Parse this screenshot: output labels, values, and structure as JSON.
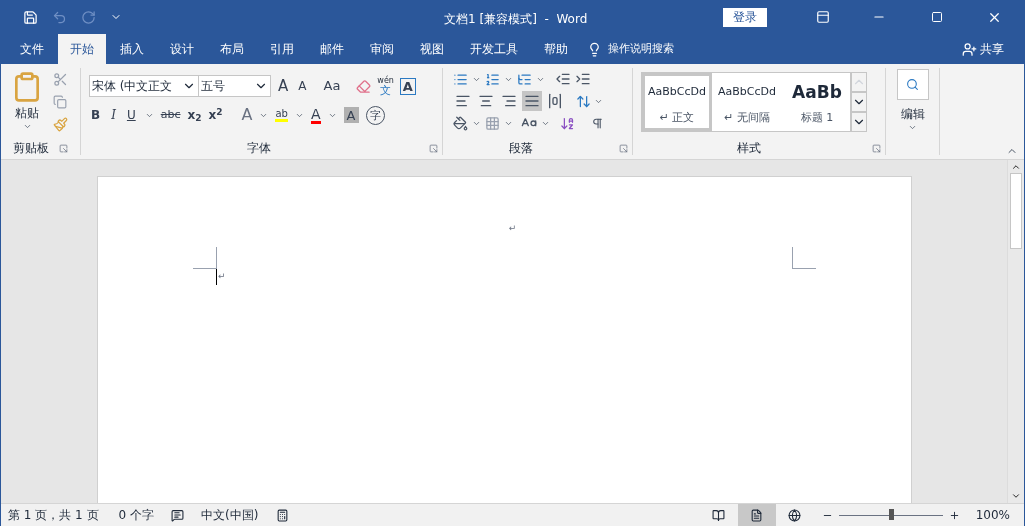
{
  "window": {
    "title": "文档1 [兼容模式]  -  Word",
    "login": "登录"
  },
  "tabs": [
    {
      "label": "文件",
      "selected": false
    },
    {
      "label": "开始",
      "selected": true
    },
    {
      "label": "插入",
      "selected": false
    },
    {
      "label": "设计",
      "selected": false
    },
    {
      "label": "布局",
      "selected": false
    },
    {
      "label": "引用",
      "selected": false
    },
    {
      "label": "邮件",
      "selected": false
    },
    {
      "label": "审阅",
      "selected": false
    },
    {
      "label": "视图",
      "selected": false
    },
    {
      "label": "开发工具",
      "selected": false
    },
    {
      "label": "帮助",
      "selected": false
    }
  ],
  "tell_me": {
    "placeholder": "操作说明搜索"
  },
  "share": "共享",
  "clipboard": {
    "paste": "粘贴",
    "label": "剪贴板"
  },
  "font": {
    "name": "宋体 (中文正文",
    "size": "五号",
    "grow": "A",
    "shrink": "A",
    "case": "Aa",
    "phonetic_top": "wén",
    "phonetic_bottom": "文",
    "border": "A",
    "bold": "B",
    "italic": "I",
    "underline": "U",
    "strike": "abc",
    "subscript": "x$_{2}$",
    "superscript": "x$^{2}$",
    "effects": "A",
    "highlight": "ab",
    "font_color": "A",
    "shading": "A",
    "enclose": "字",
    "label": "字体"
  },
  "paragraph": {
    "label": "段落",
    "alignment": [
      {
        "selected": false
      },
      {
        "selected": false
      },
      {
        "selected": false
      },
      {
        "selected": true
      },
      {
        "selected": false
      }
    ]
  },
  "styles": {
    "label": "样式",
    "items": [
      {
        "preview": "AaBbCcDd",
        "name": "↵ 正文",
        "selected": true,
        "kind": "normal"
      },
      {
        "preview": "AaBbCcDd",
        "name": "↵ 无间隔",
        "selected": false,
        "kind": "normal"
      },
      {
        "preview": "AaBb",
        "name": "标题 1",
        "selected": false,
        "kind": "heading"
      }
    ]
  },
  "editing": {
    "label": "编辑"
  },
  "document": {
    "header_mark": "↵",
    "cursor_mark": "↵"
  },
  "status_bar": {
    "page": "第 1 页，共 1 页",
    "words": "0 个字",
    "language": "中文(中国)",
    "views": [
      {
        "selected": false
      },
      {
        "selected": true
      },
      {
        "selected": false
      }
    ],
    "zoom": {
      "level": 0.5,
      "reading": "100%"
    }
  }
}
